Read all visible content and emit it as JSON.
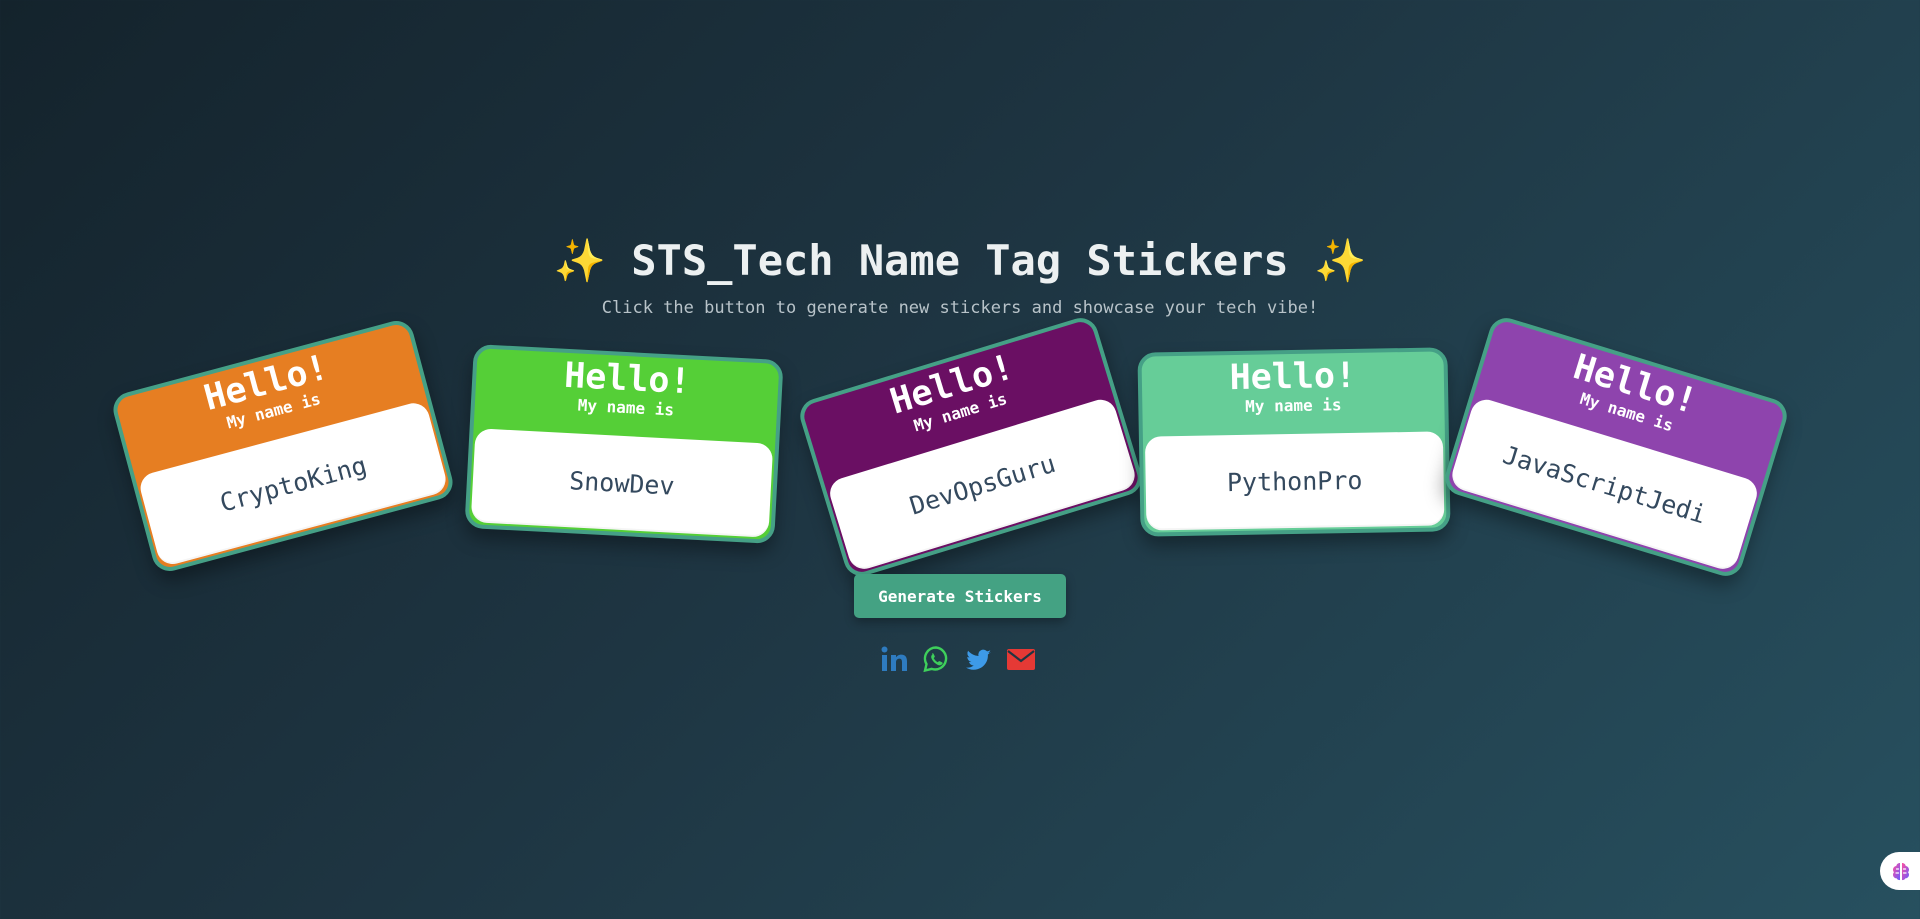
{
  "header": {
    "sparkle_left": "✨",
    "title": "STS_Tech Name Tag Stickers",
    "sparkle_right": "✨",
    "subtitle": "Click the button to generate new stickers and showcase your tech vibe!"
  },
  "stickers": [
    {
      "hello": "Hello!",
      "my_name_is": "My name is",
      "name": "CryptoKing",
      "color": "#e67e22"
    },
    {
      "hello": "Hello!",
      "my_name_is": "My name is",
      "name": "SnowDev",
      "color": "#55cf37"
    },
    {
      "hello": "Hello!",
      "my_name_is": "My name is",
      "name": "DevOpsGuru",
      "color": "#6a0f63"
    },
    {
      "hello": "Hello!",
      "my_name_is": "My name is",
      "name": "PythonPro",
      "color": "#66cd98"
    },
    {
      "hello": "Hello!",
      "my_name_is": "My name is",
      "name": "JavaScriptJedi",
      "color": "#8e44ad"
    }
  ],
  "generate_button": {
    "label": "Generate Stickers"
  },
  "social": [
    {
      "icon": "linkedin-icon",
      "color": "#2e7bbf"
    },
    {
      "icon": "whatsapp-icon",
      "color": "#3ecf5b"
    },
    {
      "icon": "twitter-icon",
      "color": "#3d9ae8"
    },
    {
      "icon": "email-icon",
      "color": "#e53935"
    }
  ],
  "colors": {
    "accent": "#44a283",
    "sticker_border": "#45a086",
    "title": "#ecf0f1",
    "subtitle": "#b8c3c9",
    "name_text": "#34495e"
  }
}
